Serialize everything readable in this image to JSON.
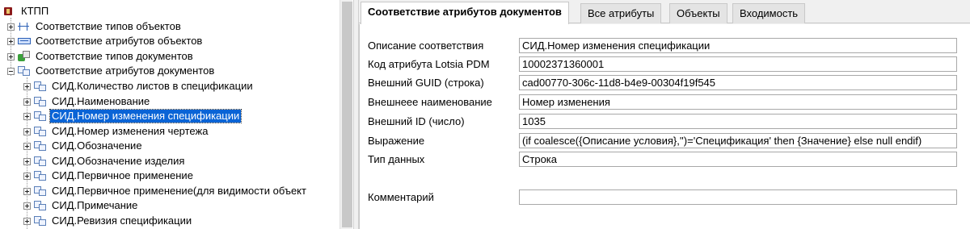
{
  "tree": {
    "root": {
      "label": "КТПП"
    },
    "groups": [
      {
        "label": "Соответствие типов объектов"
      },
      {
        "label": "Соответствие атрибутов объектов"
      },
      {
        "label": "Соответствие типов документов"
      },
      {
        "label": "Соответствие атрибутов документов"
      }
    ],
    "children": [
      {
        "label": "СИД.Количество листов в спецификации"
      },
      {
        "label": "СИД.Наименование"
      },
      {
        "label": "СИД.Номер изменения спецификации"
      },
      {
        "label": "СИД.Номер изменения чертежа"
      },
      {
        "label": "СИД.Обозначение"
      },
      {
        "label": "СИД.Обозначение изделия"
      },
      {
        "label": "СИД.Первичное применение"
      },
      {
        "label": "СИД.Первичное применение(для видимости объект"
      },
      {
        "label": "СИД.Примечание"
      },
      {
        "label": "СИД.Ревизия спецификации"
      }
    ],
    "selected_child": "СИД.Номер изменения спецификации"
  },
  "tabs": [
    {
      "label": "Соответствие атрибутов документов",
      "active": true
    },
    {
      "label": "Все атрибуты",
      "active": false
    },
    {
      "label": "Объекты",
      "active": false
    },
    {
      "label": "Входимость",
      "active": false
    }
  ],
  "form": {
    "fields": [
      {
        "label": "Описание соответствия",
        "value": "СИД.Номер изменения спецификации"
      },
      {
        "label": "Код атрибута Lotsia PDM",
        "value": "10002371360001"
      },
      {
        "label": "Внешний GUID (строка)",
        "value": "cad00770-306c-11d8-b4e9-00304f19f545"
      },
      {
        "label": "Внешнеее наименование",
        "value": "Номер изменения"
      },
      {
        "label": "Внешний ID (число)",
        "value": "1035"
      },
      {
        "label": "Выражение",
        "value": "(if coalesce({Описание условия},'')='Спецификация' then {Значение} else null endif)"
      },
      {
        "label": "Тип данных",
        "value": "Строка"
      },
      {
        "label": "Комментарий",
        "value": ""
      }
    ]
  },
  "colors": {
    "selection": "#0a64d6",
    "panel_bg": "#f0f0f0"
  }
}
